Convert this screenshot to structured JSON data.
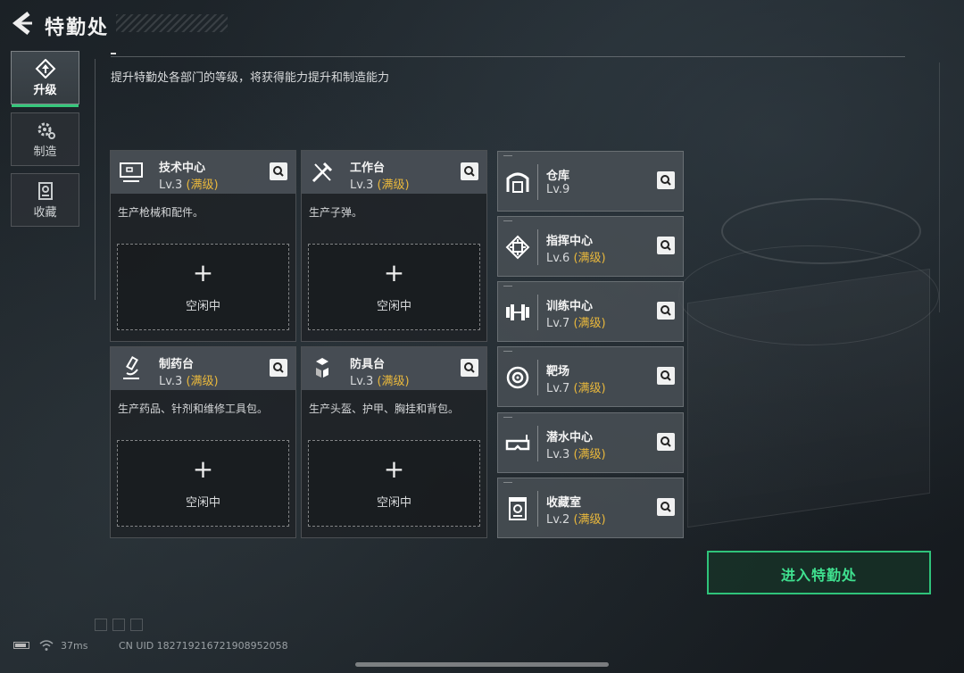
{
  "header": {
    "back_icon": "back-arrow-icon",
    "title": "特勤处"
  },
  "subtitle": "提升特勤处各部门的等级，将获得能力提升和制造能力",
  "nav": [
    {
      "label": "升级",
      "icon": "upgrade-icon",
      "active": true
    },
    {
      "label": "制造",
      "icon": "gear-icon",
      "active": false
    },
    {
      "label": "收藏",
      "icon": "collection-icon",
      "active": false
    }
  ],
  "cards": [
    {
      "name": "技术中心",
      "level": "Lv.3",
      "max": "(满级)",
      "desc": "生产枪械和配件。",
      "slot_plus": "+",
      "slot_status": "空闲中",
      "icon": "computer-icon"
    },
    {
      "name": "工作台",
      "level": "Lv.3",
      "max": "(满级)",
      "desc": "生产子弹。",
      "slot_plus": "+",
      "slot_status": "空闲中",
      "icon": "tools-icon"
    },
    {
      "name": "制药台",
      "level": "Lv.3",
      "max": "(满级)",
      "desc": "生产药品、针剂和维修工具包。",
      "slot_plus": "+",
      "slot_status": "空闲中",
      "icon": "microscope-icon"
    },
    {
      "name": "防具台",
      "level": "Lv.3",
      "max": "(满级)",
      "desc": "生产头盔、护甲、胸挂和背包。",
      "slot_plus": "+",
      "slot_status": "空闲中",
      "icon": "armor-blocks-icon"
    }
  ],
  "rows": [
    {
      "name": "仓库",
      "level": "Lv.9",
      "max": "",
      "icon": "warehouse-icon"
    },
    {
      "name": "指挥中心",
      "level": "Lv.6",
      "max": "(满级)",
      "icon": "command-chip-icon"
    },
    {
      "name": "训练中心",
      "level": "Lv.7",
      "max": "(满级)",
      "icon": "dumbbell-icon"
    },
    {
      "name": "靶场",
      "level": "Lv.7",
      "max": "(满级)",
      "icon": "target-icon"
    },
    {
      "name": "潜水中心",
      "level": "Lv.3",
      "max": "(满级)",
      "icon": "diving-mask-icon"
    },
    {
      "name": "收藏室",
      "level": "Lv.2",
      "max": "(满级)",
      "icon": "collection-room-icon"
    }
  ],
  "enter_button": "进入特勤处",
  "status": {
    "ping": "37ms",
    "uid": "CN UID 18271921672190895205​8"
  },
  "colors": {
    "accent": "#35c77b",
    "max_level": "#e9b83c",
    "button_text": "#3fe08f"
  }
}
